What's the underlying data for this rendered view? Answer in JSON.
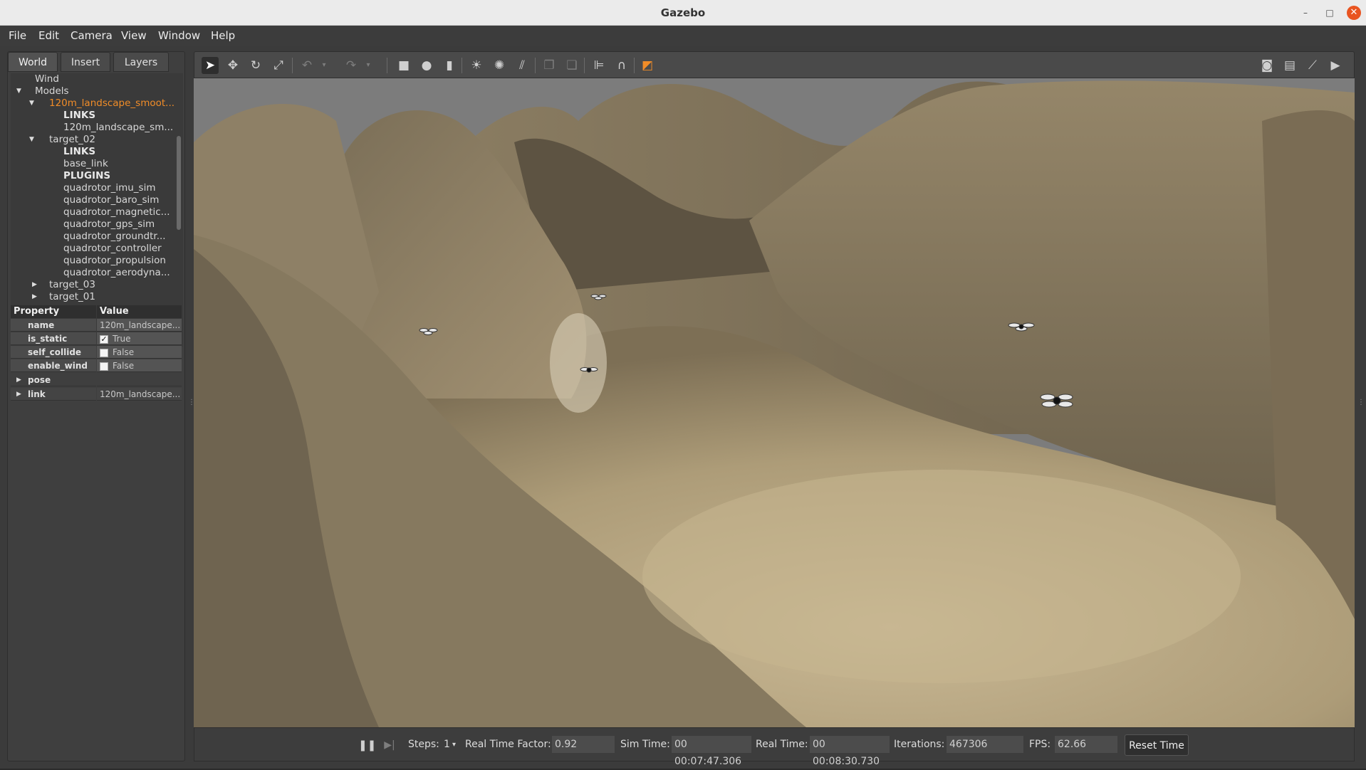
{
  "window": {
    "title": "Gazebo",
    "minimize": "–",
    "maximize": "□",
    "close": "✕"
  },
  "menu": [
    "File",
    "Edit",
    "Camera",
    "View",
    "Window",
    "Help"
  ],
  "tabs": [
    "World",
    "Insert",
    "Layers"
  ],
  "tree": {
    "wind": "Wind",
    "models": "Models",
    "items": [
      {
        "label": "120m_landscape_smoot...",
        "style": "orange"
      },
      {
        "label": "LINKS",
        "style": "bold"
      },
      {
        "label": "120m_landscape_sm...",
        "style": "normal"
      },
      {
        "label": "target_02",
        "style": "normal"
      },
      {
        "label": "LINKS",
        "style": "bold"
      },
      {
        "label": "base_link",
        "style": "normal"
      },
      {
        "label": "PLUGINS",
        "style": "bold"
      },
      {
        "label": "quadrotor_imu_sim",
        "style": "normal"
      },
      {
        "label": "quadrotor_baro_sim",
        "style": "normal"
      },
      {
        "label": "quadrotor_magnetic...",
        "style": "normal"
      },
      {
        "label": "quadrotor_gps_sim",
        "style": "normal"
      },
      {
        "label": "quadrotor_groundtr...",
        "style": "normal"
      },
      {
        "label": "quadrotor_controller",
        "style": "normal"
      },
      {
        "label": "quadrotor_propulsion",
        "style": "normal"
      },
      {
        "label": "quadrotor_aerodyna...",
        "style": "normal"
      },
      {
        "label": "target_03",
        "style": "normal"
      },
      {
        "label": "target_01",
        "style": "normal"
      }
    ]
  },
  "properties": {
    "header_property": "Property",
    "header_value": "Value",
    "rows": [
      {
        "name": "name",
        "value": "120m_landscape..."
      },
      {
        "name": "is_static",
        "value": "True",
        "checked": true
      },
      {
        "name": "self_collide",
        "value": "False",
        "checked": false
      },
      {
        "name": "enable_wind",
        "value": "False",
        "checked": false
      },
      {
        "name": "pose",
        "value": ""
      },
      {
        "name": "link",
        "value": "120m_landscape..."
      }
    ]
  },
  "toolbar_icons": [
    "select-mode-icon",
    "translate-mode-icon",
    "rotate-mode-icon",
    "scale-mode-icon",
    "undo-icon",
    "undo-history-icon",
    "redo-icon",
    "redo-history-icon",
    "box-shape-icon",
    "sphere-shape-icon",
    "cylinder-shape-icon",
    "point-light-icon",
    "spot-light-icon",
    "directional-light-icon",
    "copy-icon",
    "paste-icon",
    "align-icon",
    "snap-icon",
    "view-angle-icon",
    "screenshot-icon",
    "log-icon",
    "plot-icon",
    "record-video-icon"
  ],
  "bottom": {
    "steps_label": "Steps:",
    "steps_value": "1",
    "rtf_label": "Real Time Factor:",
    "rtf_value": "0.92",
    "sim_time_label": "Sim Time:",
    "sim_time_value": "00 00:07:47.306",
    "real_time_label": "Real Time:",
    "real_time_value": "00 00:08:30.730",
    "iterations_label": "Iterations:",
    "iterations_value": "467306",
    "fps_label": "FPS:",
    "fps_value": "62.66",
    "reset_label": "Reset Time"
  },
  "colors": {
    "selected_model": "#f08c28",
    "terrain": "#a08f6e",
    "sky": "#7c7c7c"
  }
}
